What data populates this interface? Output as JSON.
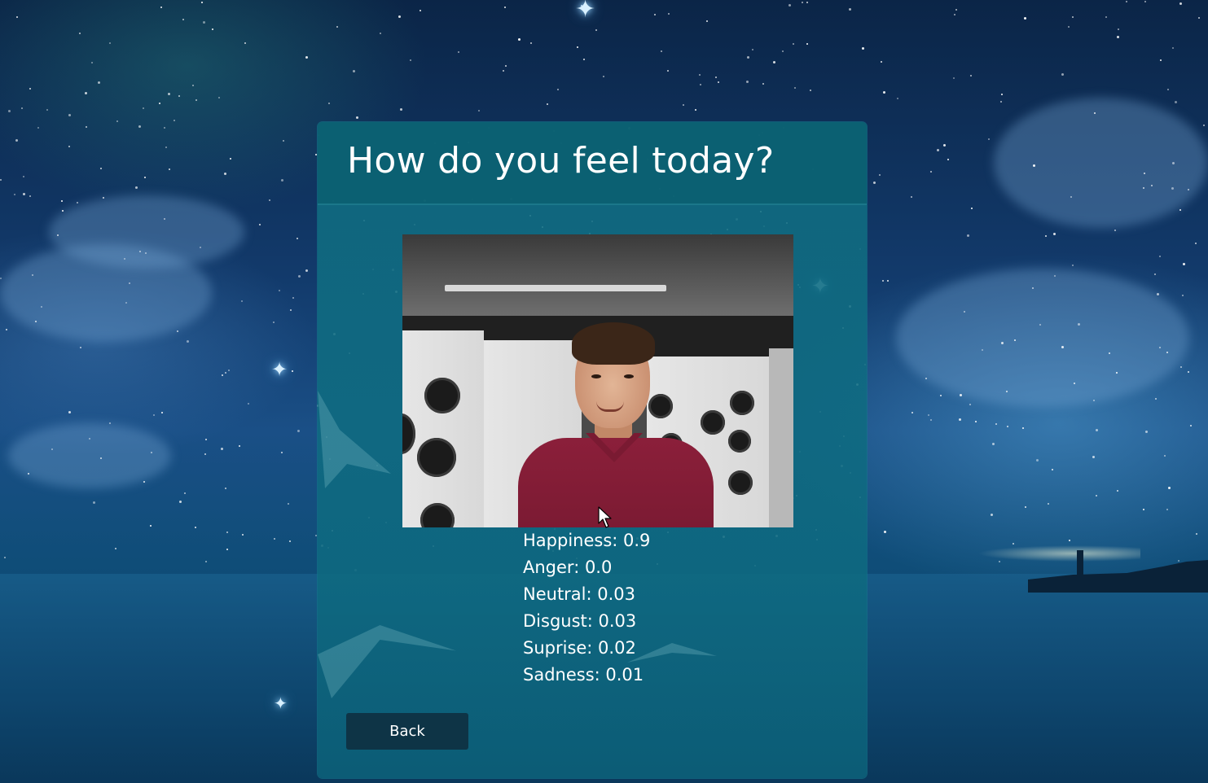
{
  "dialog": {
    "title": "How do you feel today?"
  },
  "webcam": {
    "alt": "webcam video feed"
  },
  "emotions": [
    {
      "label": "Happiness: 0.9",
      "name": "Happiness",
      "value": 0.9
    },
    {
      "label": "Anger: 0.0",
      "name": "Anger",
      "value": 0.0
    },
    {
      "label": "Neutral: 0.03",
      "name": "Neutral",
      "value": 0.03
    },
    {
      "label": "Disgust: 0.03",
      "name": "Disgust",
      "value": 0.03
    },
    {
      "label": "Suprise: 0.02",
      "name": "Suprise",
      "value": 0.02
    },
    {
      "label": "Sadness: 0.01",
      "name": "Sadness",
      "value": 0.01
    }
  ],
  "actions": {
    "back_label": "Back"
  },
  "colors": {
    "dialog_bg": "#0e6a80",
    "button_bg": "#0e3446",
    "text": "#ffffff",
    "sky": "#123a6b"
  },
  "icons": {
    "cursor": "mouse-pointer-icon",
    "sparkle": "star-sparkle-icon"
  }
}
